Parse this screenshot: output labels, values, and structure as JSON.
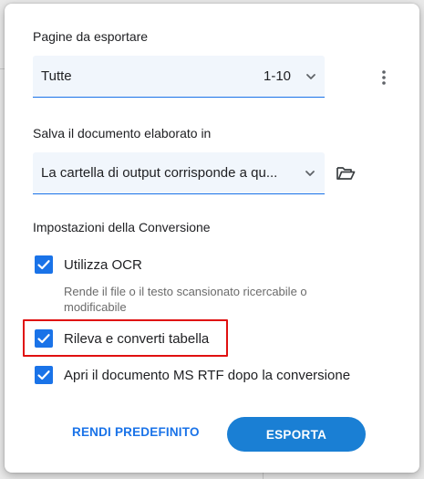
{
  "pages_section": {
    "title": "Pagine da esportare",
    "selected": "Tutte",
    "range": "1-10"
  },
  "save_section": {
    "title": "Salva il documento elaborato in",
    "selected": "La cartella di output corrisponde a qu..."
  },
  "conversion_section": {
    "title": "Impostazioni della Conversione",
    "options": [
      {
        "label": "Utilizza OCR",
        "checked": true,
        "description": "Rende il file o il testo scansionato ricercabile o modificabile"
      },
      {
        "label": "Rileva e converti tabella",
        "checked": true,
        "highlighted": true
      },
      {
        "label": "Apri il documento MS RTF dopo la conversione",
        "checked": true
      }
    ]
  },
  "actions": {
    "default_label": "RENDI PREDEFINITO",
    "export_label": "ESPORTA"
  },
  "icons": {
    "more": "more-vert-icon",
    "folder": "folder-open-icon",
    "chevron": "chevron-down-icon",
    "check": "check-icon"
  },
  "colors": {
    "accent": "#1a73e8",
    "export_button": "#1a7fd4",
    "field_bg": "#f1f6fc",
    "highlight": "#e01010"
  }
}
